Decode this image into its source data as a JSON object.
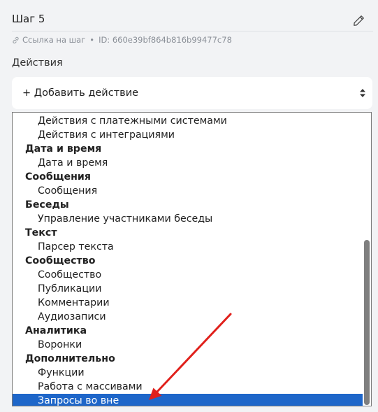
{
  "step": {
    "title": "Шаг 5",
    "link_label": "Ссылка на шаг",
    "separator": "•",
    "id_text": "ID: 660e39bf864b816b99477c78"
  },
  "actions": {
    "label": "Действия",
    "select_value": "+ Добавить действие"
  },
  "dropdown": {
    "options": [
      {
        "type": "item",
        "label": "Действия с платежными системами"
      },
      {
        "type": "item",
        "label": "Действия с интеграциями"
      },
      {
        "type": "group",
        "label": "Дата и время"
      },
      {
        "type": "item",
        "label": "Дата и время"
      },
      {
        "type": "group",
        "label": "Сообщения"
      },
      {
        "type": "item",
        "label": "Сообщения"
      },
      {
        "type": "group",
        "label": "Беседы"
      },
      {
        "type": "item",
        "label": "Управление участниками беседы"
      },
      {
        "type": "group",
        "label": "Текст"
      },
      {
        "type": "item",
        "label": "Парсер текста"
      },
      {
        "type": "group",
        "label": "Сообщество"
      },
      {
        "type": "item",
        "label": "Сообщество"
      },
      {
        "type": "item",
        "label": "Публикации"
      },
      {
        "type": "item",
        "label": "Комментарии"
      },
      {
        "type": "item",
        "label": "Аудиозаписи"
      },
      {
        "type": "group",
        "label": "Аналитика"
      },
      {
        "type": "item",
        "label": "Воронки"
      },
      {
        "type": "group",
        "label": "Дополнительно"
      },
      {
        "type": "item",
        "label": "Функции"
      },
      {
        "type": "item",
        "label": "Работа с массивами"
      },
      {
        "type": "item",
        "label": "Запросы во вне",
        "selected": true
      }
    ]
  },
  "colors": {
    "selection": "#1e66c9",
    "annotation_arrow": "#e0201b"
  },
  "icons": {
    "edit": "pencil-icon",
    "link": "link-icon",
    "select": "sort-arrows-icon"
  }
}
